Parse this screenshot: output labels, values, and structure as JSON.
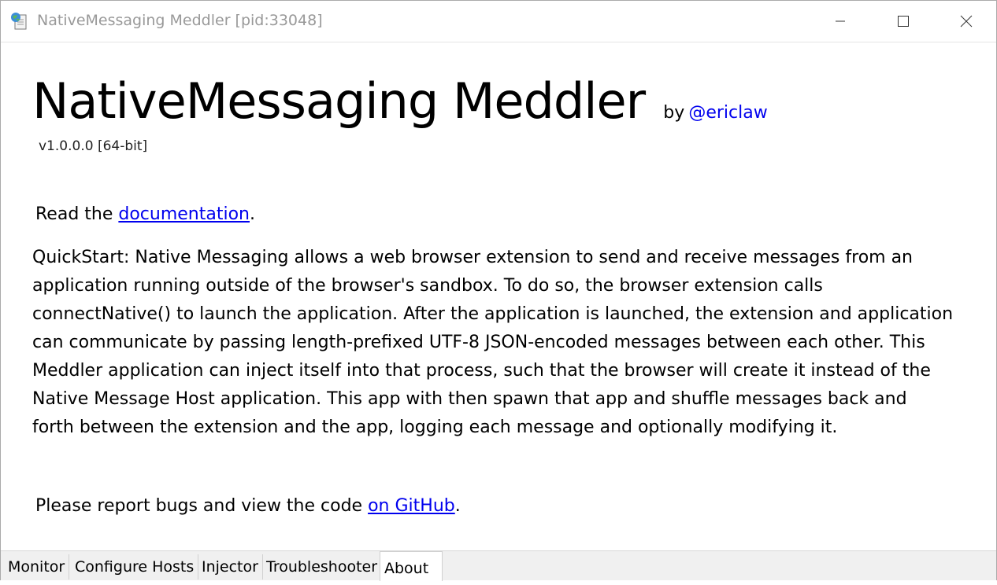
{
  "window": {
    "title": "NativeMessaging Meddler [pid:33048]"
  },
  "header": {
    "app_name": "NativeMessaging Meddler",
    "by_text": "by",
    "author_link": "@ericlaw",
    "version": "v1.0.0.0 [64-bit]"
  },
  "body": {
    "read_prefix": "Read the ",
    "documentation_link": "documentation",
    "read_suffix": ".",
    "quickstart": "QuickStart: Native Messaging allows a web browser extension to send and receive messages from an application running outside of the browser's sandbox. To do so, the browser extension calls connectNative() to launch the application. After the application is launched, the extension and application can communicate by passing length-prefixed UTF-8 JSON-encoded messages between each other. This Meddler application can inject itself into that process, such that the browser will create it instead of the Native Message Host application. This app with then spawn that app and shuffle messages back and forth between the extension and the app, logging each message and optionally modifying it.",
    "report_prefix": "Please report bugs and view the code ",
    "github_link": "on GitHub",
    "report_suffix": "."
  },
  "tabs": [
    {
      "label": "Monitor",
      "active": false
    },
    {
      "label": "Configure Hosts",
      "active": false
    },
    {
      "label": "Injector",
      "active": false
    },
    {
      "label": "Troubleshooter",
      "active": false
    },
    {
      "label": "About",
      "active": true
    }
  ],
  "colors": {
    "link": "#0000ee",
    "title_text": "#999999",
    "tabbar_bg": "#f0f0f0"
  }
}
